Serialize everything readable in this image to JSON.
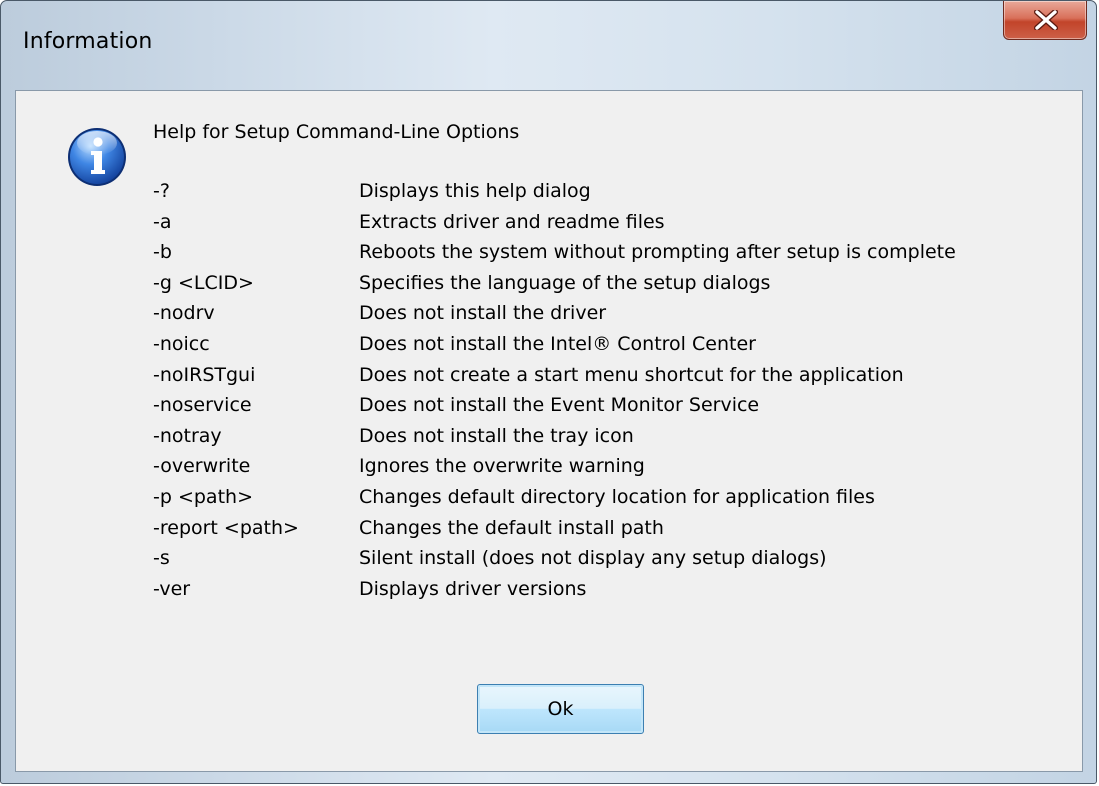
{
  "window": {
    "title": "Information",
    "close_glyph": "X",
    "icon": "information-icon"
  },
  "message": {
    "heading": "Help for Setup Command-Line Options",
    "options": [
      {
        "flag": "-?",
        "description": "Displays this help dialog"
      },
      {
        "flag": "-a",
        "description": "Extracts driver and readme files"
      },
      {
        "flag": "-b",
        "description": "Reboots the system without prompting after setup is complete"
      },
      {
        "flag": "-g <LCID>",
        "description": "Specifies the language of the setup dialogs"
      },
      {
        "flag": "-nodrv",
        "description": "Does not install the driver"
      },
      {
        "flag": "-noicc",
        "description": "Does not install the Intel® Control Center"
      },
      {
        "flag": "-noIRSTgui",
        "description": "Does not create a start menu shortcut for the application"
      },
      {
        "flag": "-noservice",
        "description": "Does not install the Event Monitor Service"
      },
      {
        "flag": "-notray",
        "description": "Does not install the tray icon"
      },
      {
        "flag": "-overwrite",
        "description": "Ignores the overwrite warning"
      },
      {
        "flag": "-p <path>",
        "description": "Changes default directory location for application files"
      },
      {
        "flag": "-report <path>",
        "description": "Changes the default install path"
      },
      {
        "flag": "-s",
        "description": "Silent install (does not display any setup dialogs)"
      },
      {
        "flag": "-ver",
        "description": "Displays driver versions"
      }
    ]
  },
  "buttons": {
    "ok_label": "Ok"
  },
  "colors": {
    "close_button": "#c7452b",
    "ok_button": "#bee6fd",
    "info_icon": "#2a66c9"
  }
}
